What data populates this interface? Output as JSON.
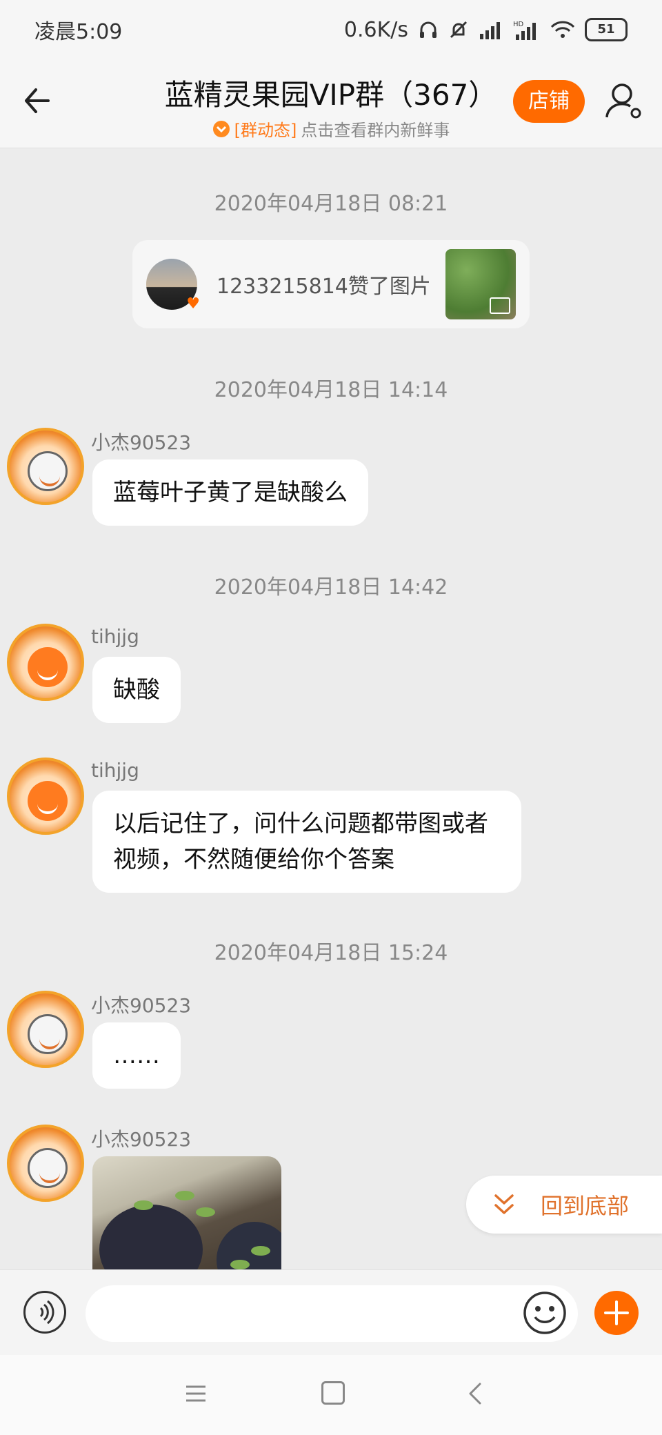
{
  "status_bar": {
    "time": "凌晨5:09",
    "speed": "0.6K/s",
    "battery": "51"
  },
  "header": {
    "title": "蓝精灵果园VIP群（367）",
    "subtitle_tag": "[群动态]",
    "subtitle_text": "点击查看群内新鲜事",
    "shop_label": "店铺"
  },
  "messages": [
    {
      "timestamp": "2020年04月18日 08:21"
    },
    {
      "like_card": {
        "text": "1233215814赞了图片"
      }
    },
    {
      "timestamp": "2020年04月18日 14:14"
    },
    {
      "sender": "小杰90523",
      "text": "蓝莓叶子黄了是缺酸么"
    },
    {
      "timestamp": "2020年04月18日 14:42"
    },
    {
      "sender": "tihjjg",
      "text": "缺酸"
    },
    {
      "sender": "tihjjg",
      "text": "以后记住了，问什么问题都带图或者视频，不然随便给你个答案"
    },
    {
      "timestamp": "2020年04月18日 15:24"
    },
    {
      "sender": "小杰90523",
      "text": "……"
    },
    {
      "sender": "小杰90523",
      "image": true
    }
  ],
  "back_to_bottom_label": "回到底部",
  "input": {
    "placeholder": ""
  },
  "colors": {
    "accent": "#ff6a00",
    "background": "#ececec"
  }
}
